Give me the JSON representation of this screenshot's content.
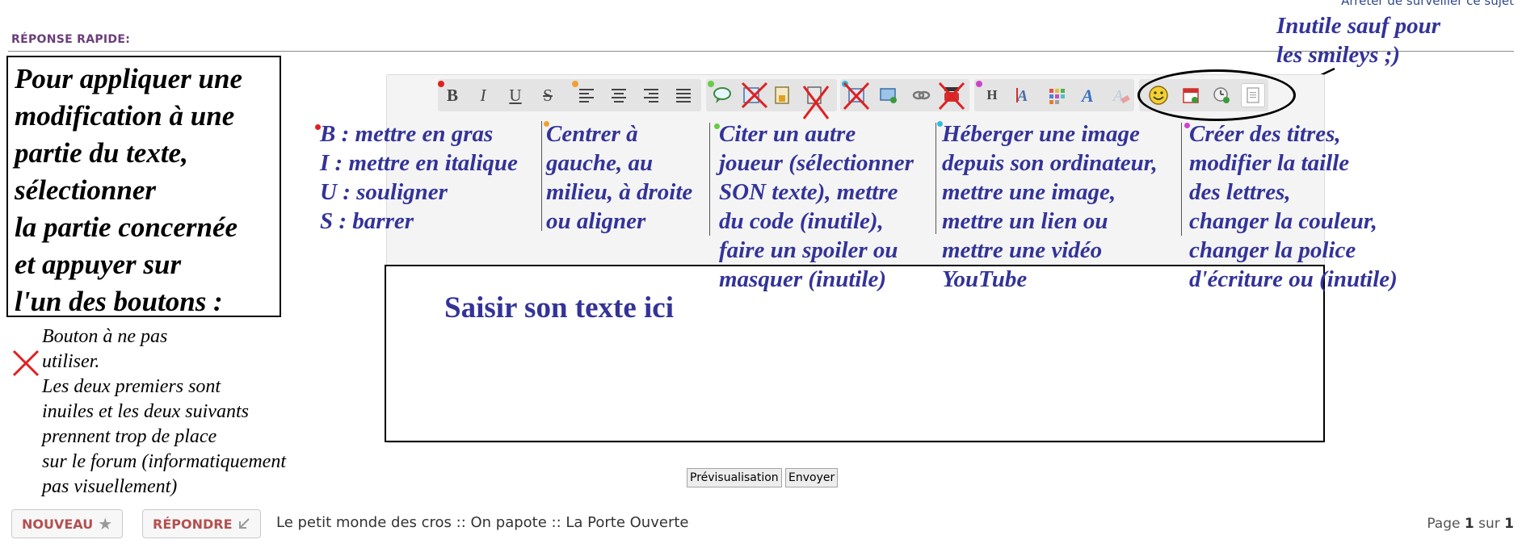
{
  "top_link": "Arrêter de surveiller ce sujet",
  "reply_title": "RÉPONSE RAPIDE:",
  "instruction_box": {
    "lines": [
      "Pour appliquer une",
      "modification à une",
      "partie du texte,",
      "sélectionner",
      "la partie concernée",
      "et appuyer sur",
      "l'un des boutons :"
    ]
  },
  "cross_note": {
    "lines": [
      "Bouton à ne pas",
      "utiliser.",
      "Les deux premiers sont",
      "inuiles et les deux suivants",
      "prennent trop de place",
      "sur le forum (informatiquement",
      "pas visuellement)"
    ]
  },
  "useless_note": {
    "lines": [
      "Inutile sauf pour",
      "les smileys ;)"
    ]
  },
  "toolbar": {
    "bold": "B",
    "italic": "I",
    "underline": "U",
    "strike": "S",
    "header": "H"
  },
  "descriptions": {
    "format": [
      "B : mettre en gras",
      "I : mettre en italique",
      "U : souligner",
      "S : barrer"
    ],
    "align": [
      "Centrer à",
      "gauche, au",
      "milieu, à droite",
      "ou aligner"
    ],
    "quote": [
      "Citer un autre",
      "joueur (sélectionner",
      "SON texte), mettre",
      "du code (inutile),",
      "faire un spoiler ou",
      "masquer (inutile)"
    ],
    "media": [
      "Héberger une image",
      "depuis son ordinateur,",
      "mettre une image,",
      "mettre un lien ou",
      "mettre une vidéo",
      "YouTube"
    ],
    "titles": [
      "Créer des titres,",
      "modifier la taille",
      "des lettres,",
      "changer la couleur,",
      "changer la police",
      "d'écriture ou (inutile)"
    ]
  },
  "textarea_label": "Saisir son texte ici",
  "buttons": {
    "preview": "Prévisualisation",
    "send": "Envoyer",
    "new": "NOUVEAU",
    "reply": "RÉPONDRE"
  },
  "breadcrumb": "Le petit monde des cros :: On papote :: La Porte Ouverte",
  "pagination": {
    "prefix": "Page",
    "current": "1",
    "sep": "sur",
    "total": "1"
  },
  "colors": {
    "annotation_blue": "#333399",
    "cross_red": "#e02020",
    "dot_format": "#e02020",
    "dot_align": "#f0a030",
    "dot_quote": "#66cc44",
    "dot_media": "#33bbdd",
    "dot_titles": "#cc44cc"
  }
}
